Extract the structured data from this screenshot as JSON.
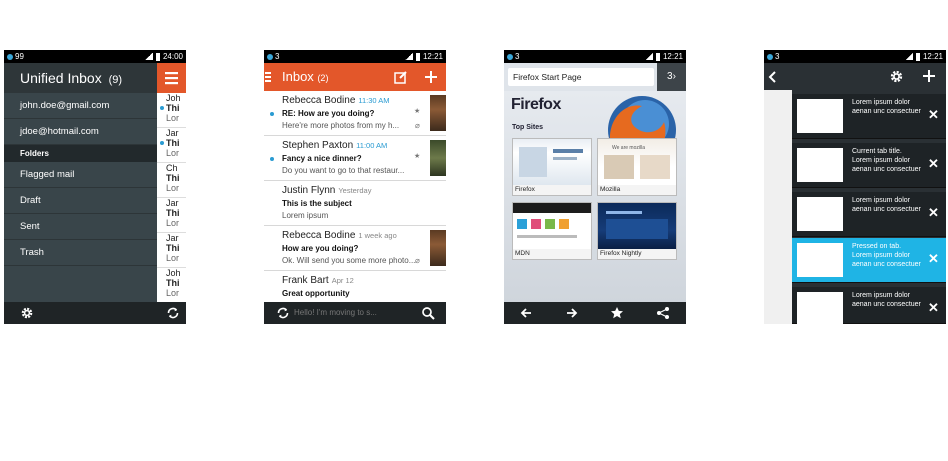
{
  "phone1": {
    "status": {
      "notif": "99",
      "time": "24:00"
    },
    "title": "Unified Inbox",
    "count": "(9)",
    "accounts": [
      "john.doe@gmail.com",
      "jdoe@hotmail.com"
    ],
    "folders_label": "Folders",
    "folders": [
      "Flagged mail",
      "Draft",
      "Sent",
      "Trash"
    ],
    "peek": [
      {
        "a": "Joh",
        "b": "Thi",
        "c": "Lor"
      },
      {
        "a": "Jar",
        "b": "Thi",
        "c": "Lor"
      },
      {
        "a": "Ch",
        "b": "Thi",
        "c": "Lor"
      },
      {
        "a": "Jar",
        "b": "Thi",
        "c": "Lor"
      },
      {
        "a": "Jar",
        "b": "Thi",
        "c": "Lor"
      },
      {
        "a": "Joh",
        "b": "Thi",
        "c": "Lor"
      }
    ]
  },
  "phone2": {
    "status": {
      "notif": "3",
      "time": "12:21"
    },
    "title": "Inbox",
    "count": "(2)",
    "messages": [
      {
        "sender": "Rebecca Bodine",
        "time": "11:30 AM",
        "subject": "RE: How are you doing?",
        "preview": "Here're more photos from my h..."
      },
      {
        "sender": "Stephen Paxton",
        "time": "11:00 AM",
        "subject": "Fancy a nice dinner?",
        "preview": "Do you want to go to that restaur..."
      },
      {
        "sender": "Justin Flynn",
        "time": "Yesterday",
        "subject": "This is the subject",
        "preview": "Lorem ipsum"
      },
      {
        "sender": "Rebecca Bodine",
        "time": "1 week ago",
        "subject": "How are you doing?",
        "preview": "Ok. Will send you some more photo..."
      },
      {
        "sender": "Frank Bart",
        "time": "Apr 12",
        "subject": "Great opportunity",
        "preview": "Hello! I'm moving to s..."
      }
    ]
  },
  "phone3": {
    "status": {
      "notif": "3",
      "time": "12:21"
    },
    "url": "Firefox Start Page",
    "tab_count": "3",
    "brand": "Firefox",
    "top_sites_label": "Top Sites",
    "sites": [
      "Firefox",
      "Mozilla",
      "MDN",
      "Firefox Nightly"
    ],
    "tile_text": {
      "mozilla": "We are mozilla"
    }
  },
  "phone4": {
    "status": {
      "notif": "3",
      "time": "12:21"
    },
    "tabs": [
      {
        "text": "Lorem ipsum dolor aenan unc consectuer"
      },
      {
        "text": "Current tab title. Lorem ipsum dolor aenan unc consectuer"
      },
      {
        "text": "Lorem ipsum dolor aenan unc consectuer"
      },
      {
        "text": "Pressed on tab. Lorem ipsum dolor aenan unc consectuer"
      },
      {
        "text": "Lorem ipsum dolor aenan unc consectuer"
      }
    ],
    "selected_tab": 3
  }
}
